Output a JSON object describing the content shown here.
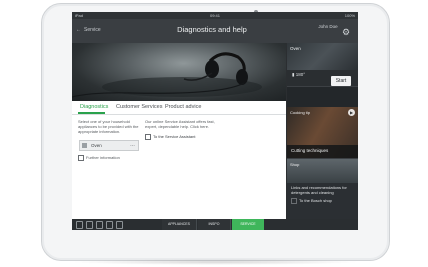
{
  "status_bar": {
    "left": "iPad",
    "center": "09:41",
    "right": "100%"
  },
  "header": {
    "back_label": "Service",
    "title": "Diagnostics and help",
    "user_name": "John Doe"
  },
  "tabs": [
    {
      "label": "Diagnostics",
      "active": true
    },
    {
      "label": "Customer Services",
      "active": false
    },
    {
      "label": "Product advice",
      "active": false
    }
  ],
  "diagnostics": {
    "instruction": "Select one of your household appliances to be provided with the appropriate information.",
    "appliance_value": "Oven",
    "further_link": "Further information"
  },
  "service": {
    "text": "Our online Service Assistant offers fast, expert, dependable help. Click here.",
    "link": "To the Service Assistant"
  },
  "right_panel": {
    "oven_card": {
      "label": "Oven",
      "temperature": "180°",
      "start_label": "Start"
    },
    "cooking_card": {
      "top_label": "Cooking tip",
      "caption": "Cutting techniques"
    },
    "shop_card": {
      "top_label": "Shop",
      "text": "Links and recommendations for detergents and cleaning",
      "link": "To the Bosch shop"
    }
  },
  "bottom_nav": {
    "items": [
      {
        "label": "APPLIANCES"
      },
      {
        "label": "INSPO"
      },
      {
        "label": "SERVICE",
        "active": true
      }
    ]
  },
  "colors": {
    "accent": "#2aa24c",
    "service_active": "#3fb65b",
    "header_bg": "#3a3e42"
  }
}
